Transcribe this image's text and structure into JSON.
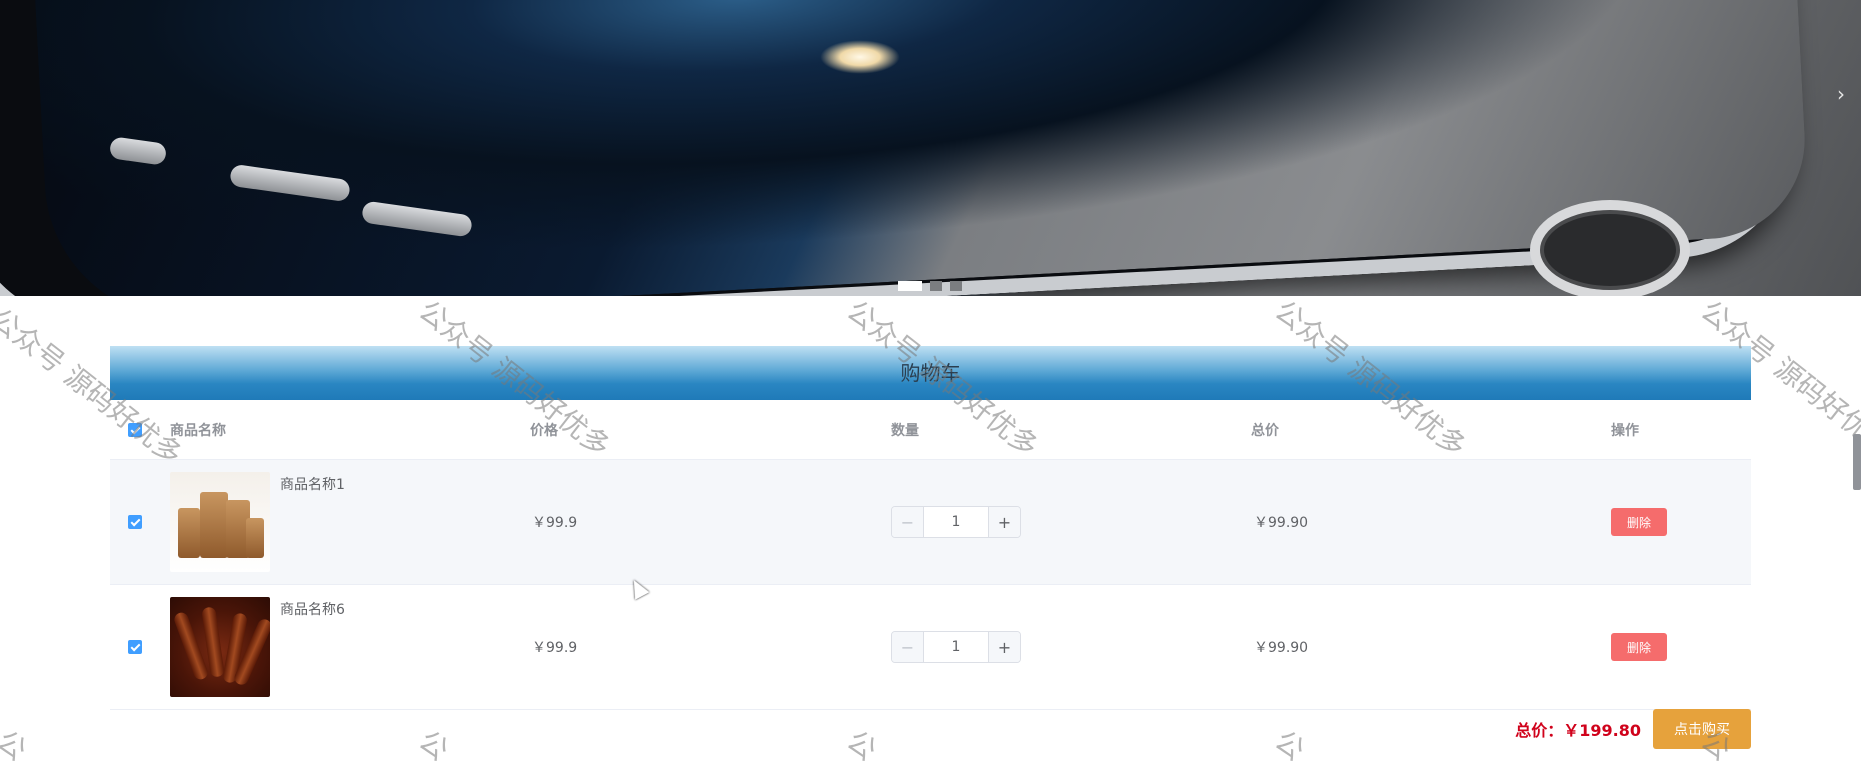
{
  "carousel": {
    "next_label": "›",
    "dots": [
      {
        "active": true
      },
      {
        "active": false
      },
      {
        "active": false
      }
    ]
  },
  "cart": {
    "title": "购物车",
    "columns": {
      "name": "商品名称",
      "price": "价格",
      "qty": "数量",
      "total": "总价",
      "action": "操作"
    },
    "items": [
      {
        "name": "商品名称1",
        "price": "￥99.9",
        "qty": "1",
        "total": "￥99.90",
        "delete_label": "删除",
        "image": "snack-gift-boxes"
      },
      {
        "name": "商品名称6",
        "price": "￥99.9",
        "qty": "1",
        "total": "￥99.90",
        "delete_label": "删除",
        "image": "braised-meat-dish"
      }
    ],
    "stepper": {
      "minus": "−",
      "plus": "+"
    },
    "footer": {
      "total_label": "总价：￥199.80",
      "buy_label": "点击购买"
    }
  },
  "watermark": {
    "text": "公众号 源码好优多",
    "partial_text": "公"
  },
  "colors": {
    "checkbox": "#409eff",
    "delete_button": "#f56c6c",
    "buy_button": "#e6a23c",
    "total_text": "#d0021b"
  }
}
